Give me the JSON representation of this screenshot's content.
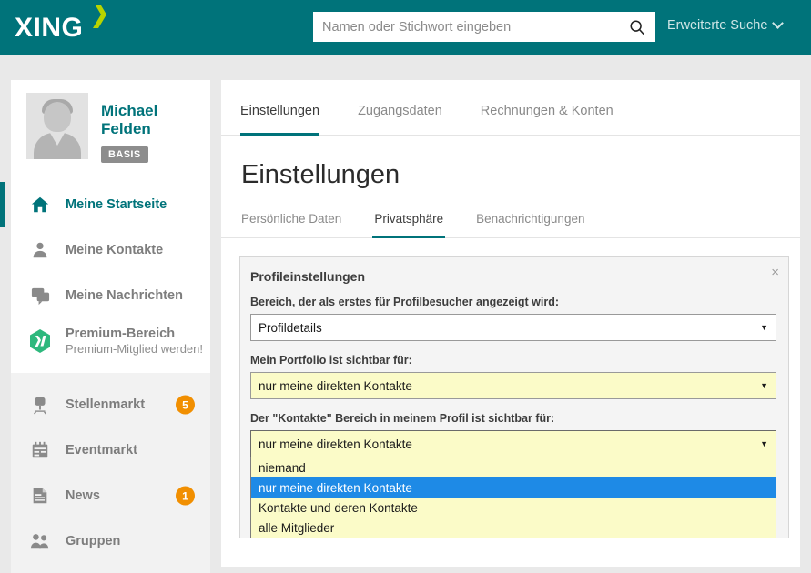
{
  "header": {
    "logo_text": "XING",
    "logo_icon": "xing-x-logo",
    "search_placeholder": "Namen oder Stichwort eingeben",
    "search_value": "",
    "search_icon": "search-icon",
    "advanced_search_label": "Erweiterte Suche",
    "advanced_search_icon": "chevron-down-icon",
    "bg_color": "#00737a"
  },
  "sidebar": {
    "profile": {
      "name": "Michael Felden",
      "membership_badge": "BASIS",
      "avatar_icon": "default-avatar-silhouette"
    },
    "primary_items": [
      {
        "label": "Meine Startseite",
        "icon": "home-icon",
        "active": true,
        "badge": null,
        "sub": null
      },
      {
        "label": "Meine Kontakte",
        "icon": "contacts-person-icon",
        "active": false,
        "badge": null,
        "sub": null
      },
      {
        "label": "Meine Nachrichten",
        "icon": "messages-bubbles-icon",
        "active": false,
        "badge": null,
        "sub": null
      },
      {
        "label": "Premium-Bereich",
        "icon": "premium-hexagon-x-icon",
        "active": false,
        "badge": null,
        "sub": "Premium-Mitglied werden!"
      }
    ],
    "secondary_items": [
      {
        "label": "Stellenmarkt",
        "icon": "office-chair-icon",
        "active": false,
        "badge": "5",
        "sub": null
      },
      {
        "label": "Eventmarkt",
        "icon": "calendar-icon",
        "active": false,
        "badge": null,
        "sub": null
      },
      {
        "label": "News",
        "icon": "news-document-icon",
        "active": false,
        "badge": "1",
        "sub": null
      },
      {
        "label": "Gruppen",
        "icon": "groups-people-icon",
        "active": false,
        "badge": null,
        "sub": null
      }
    ],
    "badge_color": "#f18f01",
    "accent_color": "#00737a"
  },
  "main": {
    "top_tabs": [
      {
        "label": "Einstellungen",
        "active": true
      },
      {
        "label": "Zugangsdaten",
        "active": false
      },
      {
        "label": "Rechnungen & Konten",
        "active": false
      }
    ],
    "page_title": "Einstellungen",
    "sub_tabs": [
      {
        "label": "Persönliche Daten",
        "active": false
      },
      {
        "label": "Privatsphäre",
        "active": true
      },
      {
        "label": "Benachrichtigungen",
        "active": false
      }
    ],
    "panel": {
      "title": "Profileinstellungen",
      "close_icon": "close-icon",
      "close_label": "×",
      "fields": [
        {
          "label": "Bereich, der als erstes für Profilbesucher angezeigt wird:",
          "value": "Profildetails",
          "highlight": false,
          "open": false,
          "arrow_icon": "chevron-down-icon",
          "arrow_glyph": "▼"
        },
        {
          "label": "Mein Portfolio ist sichtbar für:",
          "value": "nur meine direkten Kontakte",
          "highlight": true,
          "open": false,
          "arrow_icon": "chevron-down-icon",
          "arrow_glyph": "▼"
        },
        {
          "label": "Der \"Kontakte\" Bereich in meinem Profil ist sichtbar für:",
          "value": "nur meine direkten Kontakte",
          "highlight": true,
          "open": true,
          "arrow_icon": "chevron-down-icon",
          "arrow_glyph": "▼",
          "options": [
            {
              "label": "niemand",
              "selected": false
            },
            {
              "label": "nur meine direkten Kontakte",
              "selected": true
            },
            {
              "label": "Kontakte und deren Kontakte",
              "selected": false
            },
            {
              "label": "alle Mitglieder",
              "selected": false
            }
          ]
        }
      ],
      "option_highlight_color": "#1e8ae6",
      "field_highlight_color": "#fbfbc8"
    }
  }
}
